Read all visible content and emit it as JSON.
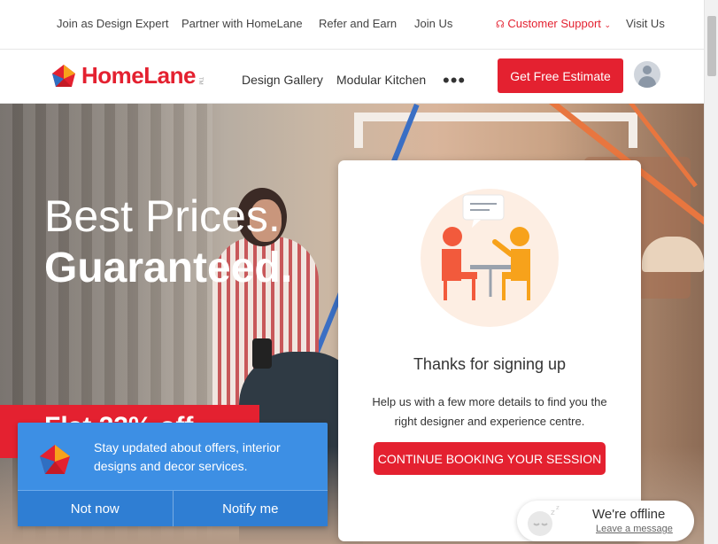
{
  "topbar": {
    "links": [
      "Join as Design Expert",
      "Partner with HomeLane",
      "Refer and Earn",
      "Join Us"
    ],
    "support_label": "Customer Support",
    "visit_label": "Visit Us"
  },
  "navbar": {
    "brand": "HomeLane",
    "brand_tm": "TM",
    "links": [
      "Design Gallery",
      "Modular Kitchen"
    ],
    "more": "•••",
    "cta": "Get Free Estimate"
  },
  "hero": {
    "line1": "Best Prices.",
    "line2": "Guaranteed.",
    "offer_partial": "Flat 23% off"
  },
  "signup_card": {
    "title": "Thanks for signing up",
    "text": "Help us with a few more details to find you the right designer and experience centre.",
    "button": "CONTINUE BOOKING YOUR SESSION"
  },
  "notification": {
    "message": "Stay updated about offers, interior designs and decor services.",
    "decline": "Not now",
    "accept": "Notify me"
  },
  "chat": {
    "status": "We're offline",
    "link": "Leave a message"
  },
  "colors": {
    "brand_red": "#e42130",
    "notify_blue": "#3d8fe4",
    "illus_bg": "#fdeee3",
    "illus_red": "#f25a3c",
    "illus_orange": "#f7a21b"
  }
}
